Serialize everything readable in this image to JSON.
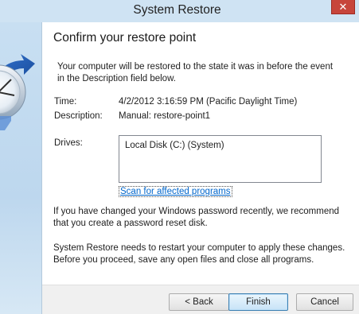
{
  "window": {
    "title": "System Restore",
    "close_glyph": "✕"
  },
  "main": {
    "heading": "Confirm your restore point",
    "intro_line1": "Your computer will be restored to the state it was in before the event",
    "intro_line2": "in the Description field below.",
    "time_label": "Time:",
    "time_value": "4/2/2012 3:16:59 PM (Pacific Daylight Time)",
    "description_label": "Description:",
    "description_value": "Manual: restore-point1",
    "drives_label": "Drives:",
    "drives": [
      "Local Disk (C:) (System)"
    ],
    "scan_link": "Scan for affected programs",
    "password_note_line1": "If you have changed your Windows password recently, we recommend",
    "password_note_line2": "that you create a password reset disk.",
    "restart_note_line1": "System Restore needs to restart your computer to apply these changes.",
    "restart_note_line2": "Before you proceed, save any open files and close all programs."
  },
  "buttons": {
    "back": "< Back",
    "finish": "Finish",
    "cancel": "Cancel"
  },
  "icons": {
    "side_art": "system-restore-clock-icon",
    "close": "close-icon"
  },
  "colors": {
    "frame": "#cfe3f3",
    "close_button": "#c7453b",
    "link": "#0066cc",
    "default_button_border": "#3c7fb1"
  }
}
